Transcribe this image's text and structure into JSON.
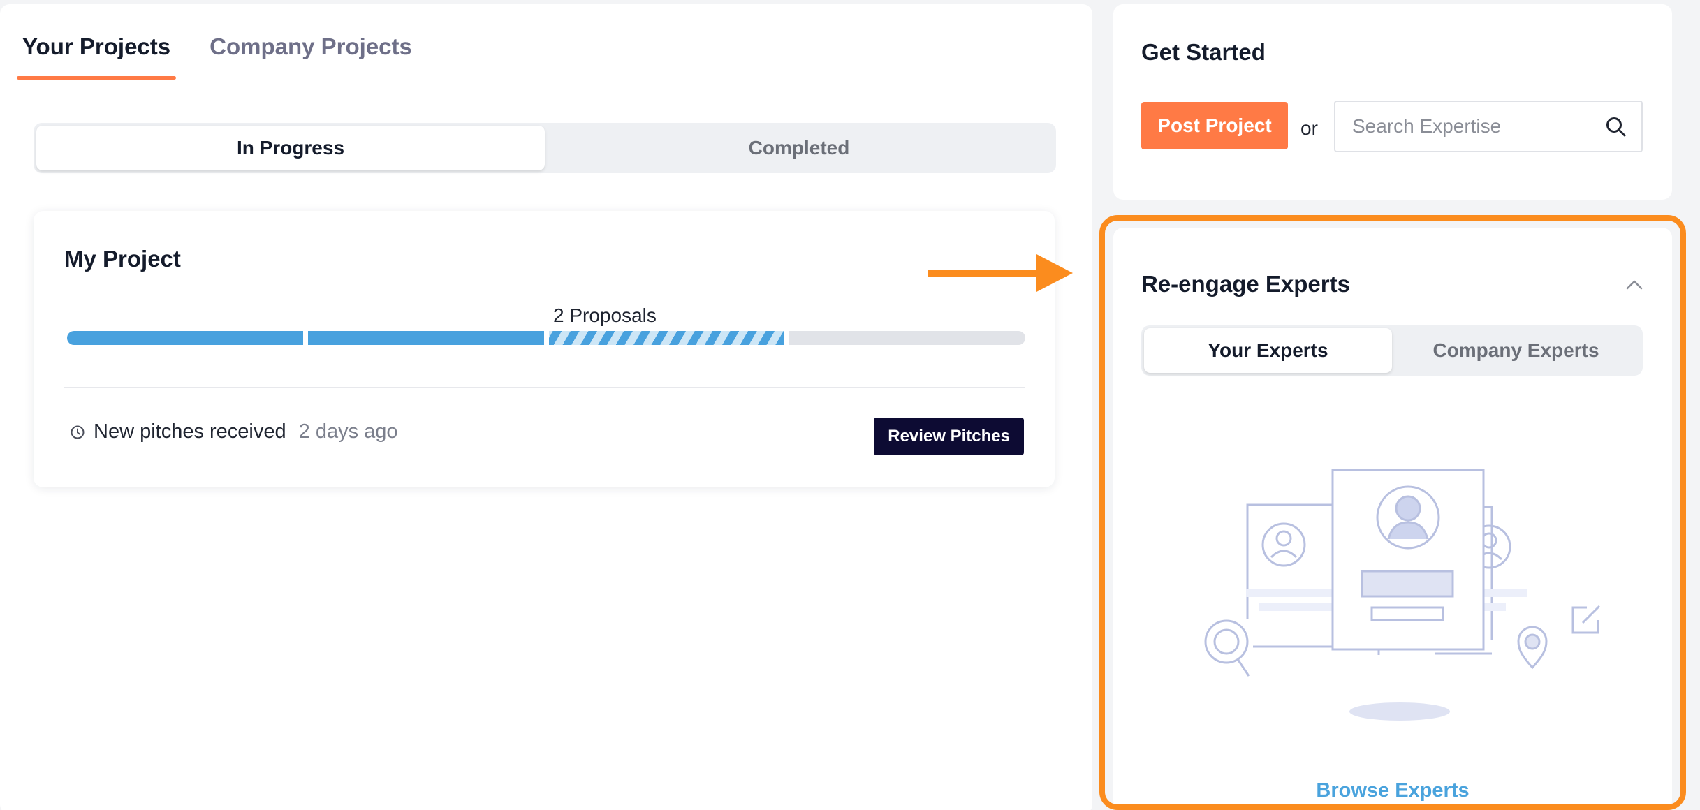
{
  "projects_panel": {
    "tabs": [
      {
        "label": "Your Projects",
        "active": true
      },
      {
        "label": "Company Projects",
        "active": false
      }
    ],
    "status_segment": [
      {
        "label": "In Progress",
        "active": true
      },
      {
        "label": "Completed",
        "active": false
      }
    ],
    "project_card": {
      "title": "My Project",
      "stage_label": "2 Proposals",
      "progress": {
        "total_segments": 4,
        "filled_segments": 2,
        "in_progress_segment": 3
      },
      "status_icon": "clock-icon",
      "status_text": "New pitches received",
      "status_time": "2 days ago",
      "action_label": "Review Pitches"
    }
  },
  "get_started": {
    "title": "Get Started",
    "post_button": "Post Project",
    "or_text": "or",
    "search_placeholder": "Search Expertise",
    "search_value": "",
    "search_icon": "search-icon"
  },
  "reengage": {
    "title": "Re-engage Experts",
    "collapse_icon": "chevron-up-icon",
    "segment": [
      {
        "label": "Your Experts",
        "active": true
      },
      {
        "label": "Company Experts",
        "active": false
      }
    ],
    "illustration": "experts-empty-state-illustration",
    "browse_link": "Browse Experts"
  },
  "annotation": {
    "arrow_icon": "arrow-right-icon",
    "arrow_color": "#fb8c1e",
    "highlight_color": "#fb8c1e"
  },
  "colors": {
    "accent_orange": "#ff7a45",
    "progress_blue": "#48a1de",
    "dark_button": "#0d0b33",
    "link_blue": "#4aa3dd"
  }
}
